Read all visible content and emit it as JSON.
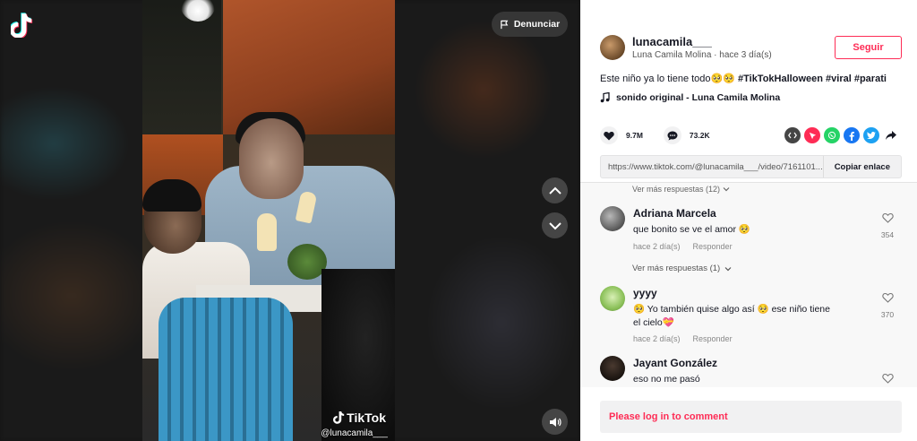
{
  "video": {
    "report_label": "Denunciar",
    "watermark": "TikTok",
    "watermark_user": "@lunacamila___"
  },
  "author": {
    "username": "lunacamila___",
    "display_name": "Luna Camila Molina",
    "posted": "hace 3 día(s)",
    "follow_label": "Seguir"
  },
  "caption": {
    "text": "Este niño ya lo tiene todo🥺🥺",
    "hashtags": [
      "#TikTokHalloween",
      "#viral",
      "#parati"
    ]
  },
  "sound": "sonido original - Luna Camila Molina",
  "stats": {
    "likes": "9.7M",
    "comments": "73.2K"
  },
  "share_icons": [
    "embed-icon",
    "send-icon",
    "whatsapp-icon",
    "facebook-icon",
    "twitter-icon",
    "share-arrow-icon"
  ],
  "link": {
    "url": "https://www.tiktok.com/@lunacamila___/video/7161101...",
    "copy_label": "Copiar enlace"
  },
  "comments": {
    "top_more": "Ver más respuestas (12)",
    "items": [
      {
        "user": "Adriana Marcela",
        "text": "que bonito se ve el amor 🥺",
        "date": "hace 2 día(s)",
        "reply": "Responder",
        "likes": "354",
        "more": "Ver más respuestas (1)"
      },
      {
        "user": "yyyy",
        "text": "🥺 Yo también quise algo así 🥺 ese niño tiene el cielo💝",
        "date": "hace 2 día(s)",
        "reply": "Responder",
        "likes": "370"
      },
      {
        "user": "Jayant González",
        "text": "eso no me pasó"
      }
    ]
  },
  "login_prompt": "Please log in to comment",
  "colors": {
    "accent": "#fe2c55",
    "text": "#161823"
  }
}
